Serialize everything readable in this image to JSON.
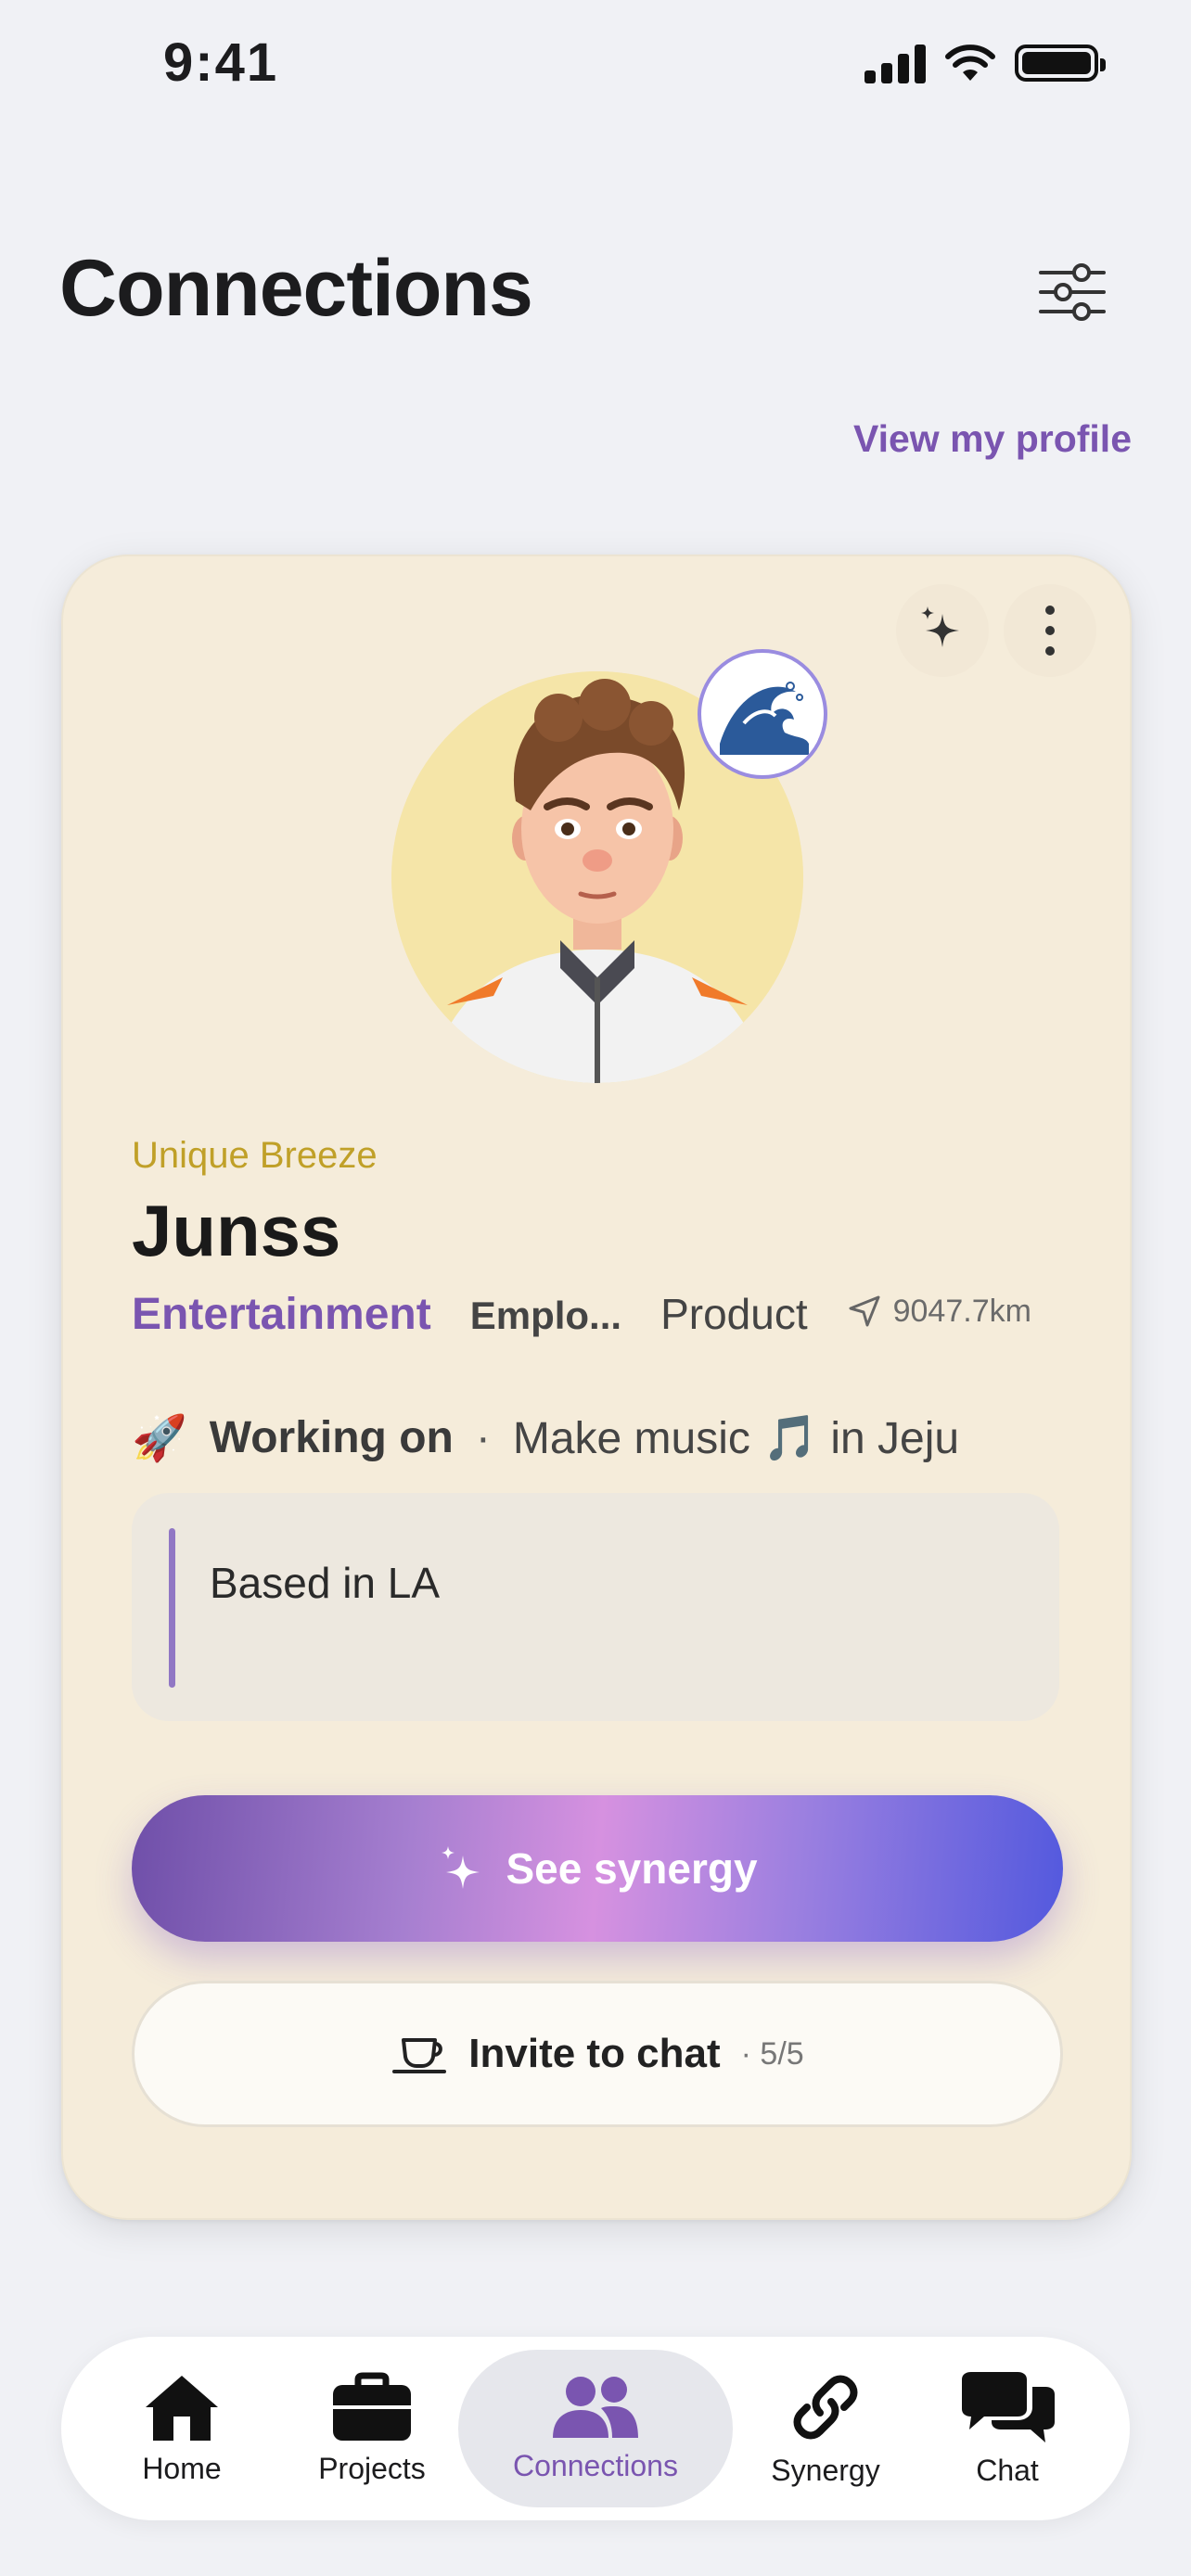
{
  "status_bar": {
    "time": "9:41"
  },
  "header": {
    "title": "Connections",
    "view_profile": "View my profile"
  },
  "card": {
    "nickname": "Unique Breeze",
    "name": "Junss",
    "industry": "Entertainment",
    "employment": "Emplo...",
    "role": "Product",
    "distance": "9047.7km",
    "working_on_emoji": "🚀",
    "working_on_label": "Working on",
    "working_on_separator": "·",
    "working_on_text": "Make music 🎵 in Jeju",
    "bio": "Based in LA",
    "synergy_button": "See synergy",
    "invite_button": "Invite to chat",
    "invite_count": "· 5/5"
  },
  "tabs": [
    {
      "label": "Home",
      "icon": "home-icon"
    },
    {
      "label": "Projects",
      "icon": "briefcase-icon"
    },
    {
      "label": "Connections",
      "icon": "people-icon",
      "active": true
    },
    {
      "label": "Synergy",
      "icon": "link-icon"
    },
    {
      "label": "Chat",
      "icon": "chat-bubbles-icon"
    }
  ],
  "colors": {
    "accent": "#7a55b0",
    "nickname": "#c0a028",
    "card_bg": "#f5ecda",
    "background": "#f0f1f5"
  }
}
